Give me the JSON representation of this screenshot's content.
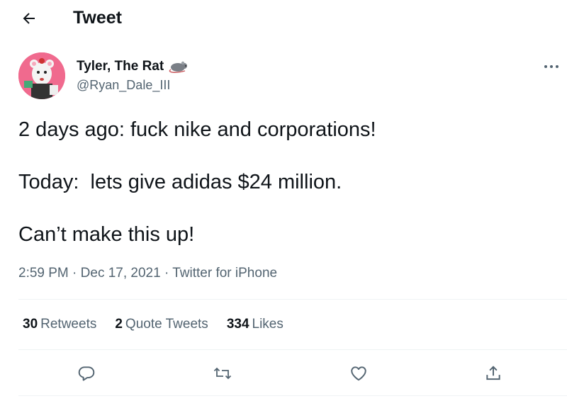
{
  "header": {
    "title": "Tweet",
    "back_icon": "arrow-left-icon"
  },
  "author": {
    "name": "Tyler, The Rat",
    "name_emoji": "rat-emoji",
    "handle": "@Ryan_Dale_III",
    "more_icon": "more-dots-icon"
  },
  "tweet": {
    "lines": [
      "2 days ago: fuck nike and corporations!",
      "",
      "Today:  lets give adidas $24 million.",
      "",
      "Can’t make this up!"
    ]
  },
  "meta": {
    "time": "2:59 PM",
    "separator": "·",
    "date": "Dec 17, 2021",
    "source": "Twitter for iPhone"
  },
  "stats": {
    "retweets": {
      "count": "30",
      "label": "Retweets"
    },
    "quotes": {
      "count": "2",
      "label": "Quote Tweets"
    },
    "likes": {
      "count": "334",
      "label": "Likes"
    }
  },
  "actions": {
    "reply_icon": "reply-icon",
    "retweet_icon": "retweet-icon",
    "like_icon": "heart-icon",
    "share_icon": "share-icon"
  },
  "colors": {
    "text": "#0f1419",
    "secondary": "#536471",
    "divider": "#eff3f4",
    "avatar_bg": "#f06a8e"
  }
}
